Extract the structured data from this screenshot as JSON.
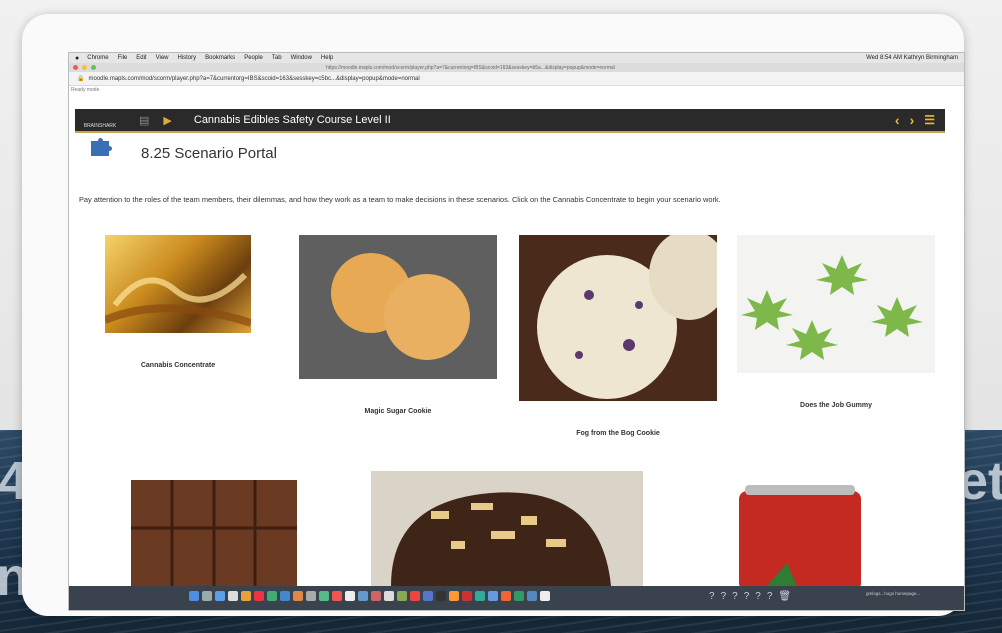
{
  "browser": {
    "menu": [
      "Chrome",
      "File",
      "Edit",
      "View",
      "History",
      "Bookmarks",
      "People",
      "Tab",
      "Window",
      "Help"
    ],
    "status_right": "Wed 8:54 AM  Kathryn Birmingham",
    "tab_url": "https://moodle.mapls.com/mod/scorm/player.php?a=7&currentorg=IBS&scoid=163&sesskey=b5a...&display=popup&mode=normal",
    "address": "moodle.mapls.com/mod/scorm/player.php?a=7&currentorg=IBS&scoid=163&sesskey=c5bc...&display=popup&mode=normal",
    "status_line": "Ready mode"
  },
  "course": {
    "logo_text": "BRAINSHARK",
    "title": "Cannabis Edibles Safety Course Level II"
  },
  "page": {
    "title": "8.25 Scenario Portal",
    "intro": "Pay attention to the roles of the team members, their dilemmas, and how they work as a team to make decisions in these scenarios. Click on the Cannabis Concentrate to begin your scenario work."
  },
  "cards": [
    {
      "label": "Cannabis Concentrate",
      "image_icon": "concentrate-image"
    },
    {
      "label": "Magic Sugar Cookie",
      "image_icon": "sugar-cookie-image"
    },
    {
      "label": "Fog from the Bog Cookie",
      "image_icon": "bog-cookie-image"
    },
    {
      "label": "Does the Job Gummy",
      "image_icon": "gummy-image"
    }
  ],
  "row2_images": [
    "chocolate-bar-image",
    "chocolate-dessert-image",
    "soda-can-image"
  ],
  "backdrop_text": {
    "left": "4",
    "right": "et",
    "bottom_left": "n."
  },
  "dock": {
    "clock_text": "gmlogs...hogs  homepage..."
  },
  "colors": {
    "accent": "#f0b53c",
    "course_bar": "#2a2a2a",
    "puzzle": "#3b6fb5"
  }
}
